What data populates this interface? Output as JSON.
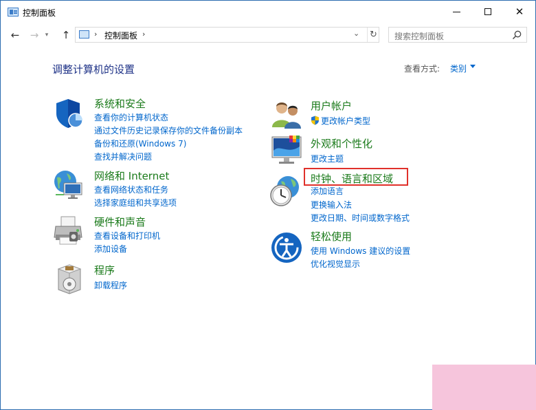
{
  "window": {
    "title": "控制面板"
  },
  "address": {
    "path": "控制面板",
    "search_placeholder": "搜索控制面板"
  },
  "heading": "调整计算机的设置",
  "viewby": {
    "label": "查看方式:",
    "value": "类别"
  },
  "left": [
    {
      "title": "系统和安全",
      "links": [
        "查看你的计算机状态",
        "通过文件历史记录保存你的文件备份副本",
        "备份和还原(Windows 7)",
        "查找并解决问题"
      ]
    },
    {
      "title": "网络和 Internet",
      "links": [
        "查看网络状态和任务",
        "选择家庭组和共享选项"
      ]
    },
    {
      "title": "硬件和声音",
      "links": [
        "查看设备和打印机",
        "添加设备"
      ]
    },
    {
      "title": "程序",
      "links": [
        "卸载程序"
      ]
    }
  ],
  "right": [
    {
      "title": "用户帐户",
      "links": [
        "更改帐户类型"
      ]
    },
    {
      "title": "外观和个性化",
      "links": [
        "更改主题"
      ]
    },
    {
      "title": "时钟、语言和区域",
      "links": [
        "添加语言",
        "更换输入法",
        "更改日期、时间或数字格式"
      ]
    },
    {
      "title": "轻松使用",
      "links": [
        "使用 Windows 建议的设置",
        "优化视觉显示"
      ]
    }
  ],
  "colors": {
    "category": "#1a7a1a",
    "link": "#0066cc",
    "heading": "#1e3287",
    "highlight": "#e0302a"
  }
}
